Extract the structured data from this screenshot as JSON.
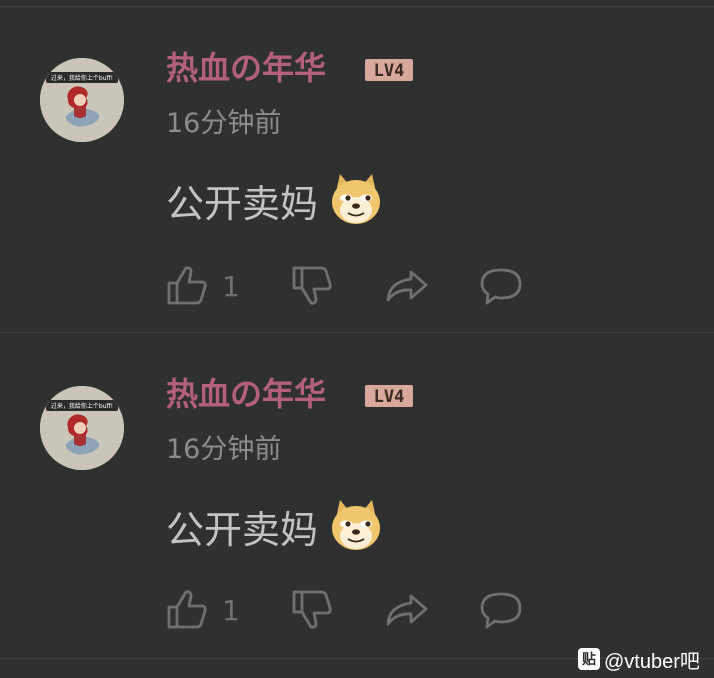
{
  "comments": [
    {
      "username": "热血の年华",
      "level": "LV4",
      "avatar_caption": "过来，我给你上个buff!",
      "time": "16分钟前",
      "text": "公开卖妈",
      "emoji_icon": "doge-emoji-icon",
      "likes": "1"
    },
    {
      "username": "热血の年华",
      "level": "LV4",
      "avatar_caption": "过来，我给你上个buff!",
      "time": "16分钟前",
      "text": "公开卖妈",
      "emoji_icon": "doge-emoji-icon",
      "likes": "1"
    }
  ],
  "watermark": {
    "icon_text": "贴",
    "text": "@vtuber吧"
  },
  "colors": {
    "background": "#2f3130",
    "username": "#b5607a",
    "badge": "#d7a89b",
    "text": "#c2c4c3",
    "muted": "#8b8d8c",
    "icon": "#6f7170"
  }
}
